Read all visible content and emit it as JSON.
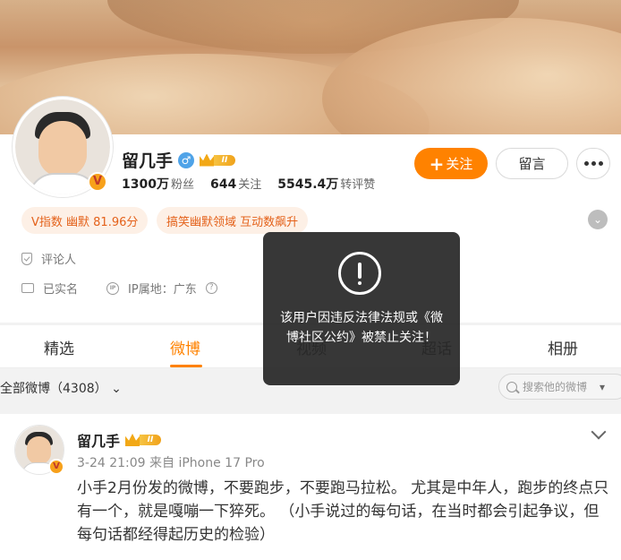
{
  "profile": {
    "username": "留几手",
    "level_badge": "II",
    "stats": [
      {
        "value": "1300万",
        "label": "粉丝"
      },
      {
        "value": "644",
        "label": "关注"
      },
      {
        "value": "5545.4万",
        "label": "转评赞"
      }
    ],
    "follow_button": "关注",
    "message_button": "留言",
    "tags": [
      "V指数 幽默 81.96分",
      "搞笑幽默领域 互动数飙升"
    ],
    "info": {
      "role": "评论人",
      "verified": "已实名",
      "ip_location": "IP属地：广东"
    }
  },
  "tabs": [
    "精选",
    "微博",
    "视频",
    "超话",
    "相册"
  ],
  "active_tab": "微博",
  "filter": {
    "label": "全部微博（4308）",
    "search_placeholder": "搜索他的微博"
  },
  "post": {
    "author": "留几手",
    "meta": "3-24 21:09  来自 iPhone 17 Pro",
    "text": "小手2月份发的微博，不要跑步，不要跑马拉松。 尤其是中年人，跑步的终点只有一个，就是嘎嘣一下猝死。 （小手说过的每句话，在当时都会引起争议，但每句话都经得起历史的检验）"
  },
  "toast": {
    "message": "该用户因违反法律法规或《微博社区公约》被禁止关注！"
  },
  "colors": {
    "accent": "#ff8200",
    "tag_text": "#e4621b",
    "tag_bg": "#fdf0e6"
  }
}
